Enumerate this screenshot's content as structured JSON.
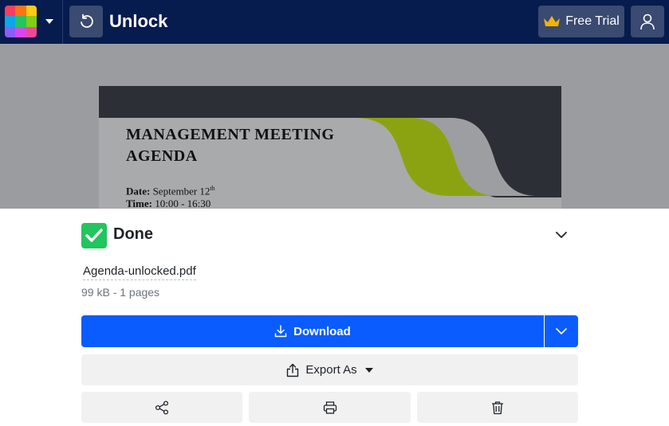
{
  "header": {
    "title": "Unlock",
    "free_trial_label": "Free Trial",
    "logo_colors": [
      "#f43f5e",
      "#f97316",
      "#facc15",
      "#0ea5e9",
      "#22c55e",
      "#84cc16",
      "#8b5cf6",
      "#d946ef",
      "#ec4899"
    ],
    "bar_color": "#061C4E"
  },
  "preview": {
    "doc_title_line1": "MANAGEMENT MEETING",
    "doc_title_line2": "AGENDA",
    "date_label": "Date:",
    "date_value": "September 12",
    "date_suffix": "th",
    "time_label": "Time:",
    "time_value": "10:00 - 16:30"
  },
  "result": {
    "status": "Done",
    "filename": "Agenda-unlocked.pdf",
    "file_info": "99 kB - 1 pages",
    "download_label": "Download",
    "export_label": "Export As",
    "accent_color": "#0a5cff",
    "success_color": "#22c55e"
  },
  "icons": {
    "back": "undo-icon",
    "crown": "crown-icon",
    "user": "user-icon",
    "check": "check-icon",
    "collapse": "chevron-down-icon",
    "download": "download-icon",
    "export": "share-upload-icon",
    "share": "share-nodes-icon",
    "print": "printer-icon",
    "delete": "trash-icon"
  }
}
